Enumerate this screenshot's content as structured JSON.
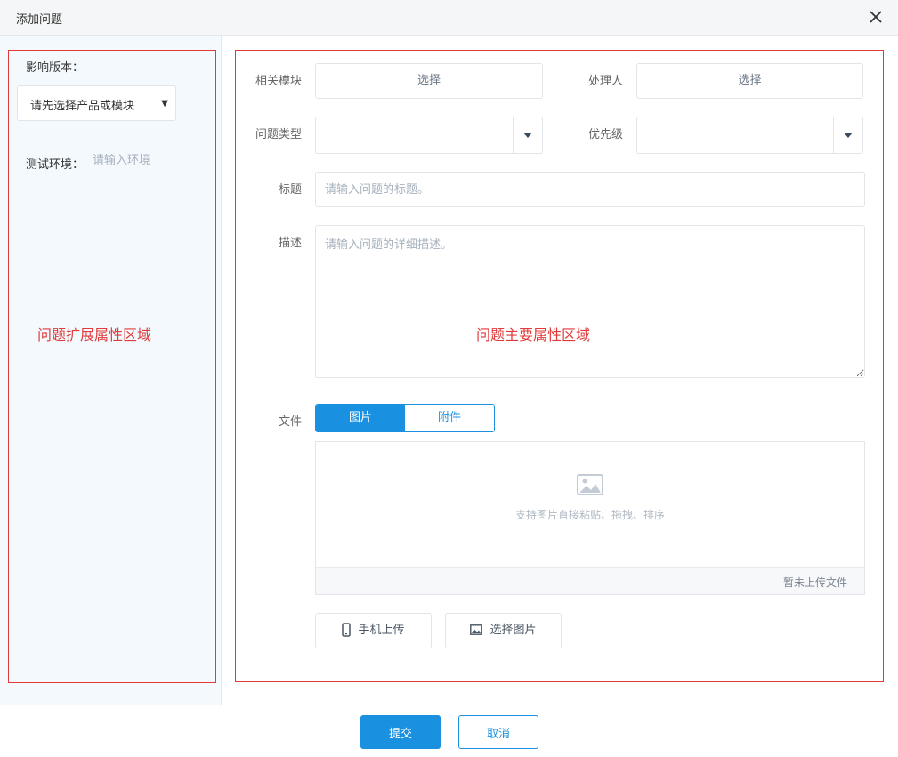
{
  "dialog": {
    "title": "添加问题"
  },
  "sidebar": {
    "version_label": "影响版本：",
    "version_select_value": "请先选择产品或模块",
    "env_label": "测试环境：",
    "env_placeholder": "请输入环境",
    "region_label": "问题扩展属性区域"
  },
  "main": {
    "region_label": "问题主要属性区域",
    "module_label": "相关模块",
    "module_select": "选择",
    "assignee_label": "处理人",
    "assignee_select": "选择",
    "type_label": "问题类型",
    "priority_label": "优先级",
    "title_label": "标题",
    "title_placeholder": "请输入问题的标题。",
    "desc_label": "描述",
    "desc_placeholder": "请输入问题的详细描述。",
    "file_label": "文件",
    "tabs": [
      "图片",
      "附件"
    ],
    "drop_hint": "支持图片直接粘贴、拖拽、排序",
    "no_file_text": "暂未上传文件",
    "mobile_upload": "手机上传",
    "choose_image": "选择图片"
  },
  "footer": {
    "submit": "提交",
    "cancel": "取消"
  },
  "colors": {
    "primary": "#1a90e0",
    "annotation": "#e03a3a",
    "sidebar_bg": "#f3f9fd"
  },
  "icons": [
    "close-icon",
    "caret-down-icon",
    "image-icon",
    "mobile-icon"
  ]
}
